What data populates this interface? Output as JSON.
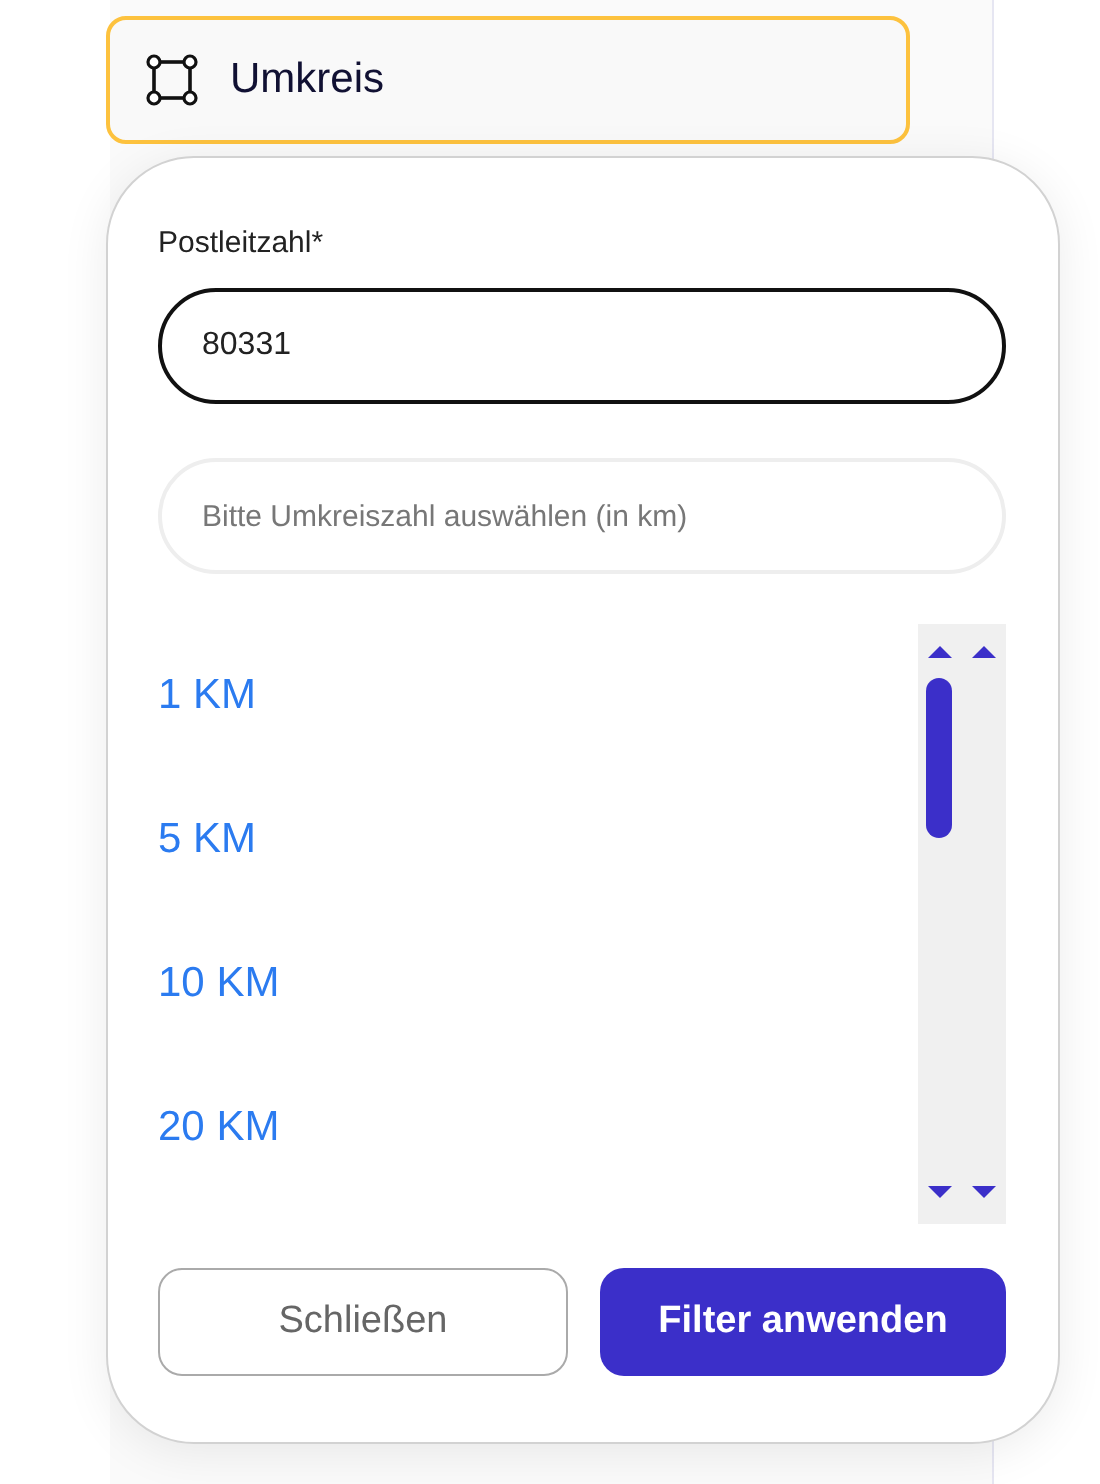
{
  "trigger": {
    "label": "Umkreis",
    "active": true
  },
  "postal_code": {
    "label": "Postleitzahl*",
    "value": "80331"
  },
  "radius_search": {
    "placeholder": "Bitte Umkreiszahl auswählen (in km)"
  },
  "radius_options": [
    {
      "label": "1 KM"
    },
    {
      "label": "5 KM"
    },
    {
      "label": "10 KM"
    },
    {
      "label": "20 KM"
    }
  ],
  "buttons": [
    {
      "label": "Schließen",
      "kind": "secondary"
    },
    {
      "label": "Filter anwenden",
      "kind": "primary"
    }
  ]
}
